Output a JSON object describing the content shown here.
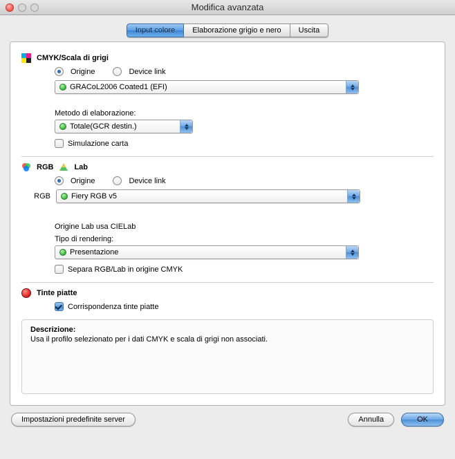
{
  "window": {
    "title": "Modifica avanzata"
  },
  "tabs": {
    "items": [
      {
        "label": "Input colore",
        "active": true
      },
      {
        "label": "Elaborazione grigio e nero",
        "active": false
      },
      {
        "label": "Uscita",
        "active": false
      }
    ]
  },
  "cmyk": {
    "heading": "CMYK/Scala di grigi",
    "radio_source": "Origine",
    "radio_devicelink": "Device link",
    "profile": "GRACoL2006 Coated1 (EFI)",
    "processing_label": "Metodo di elaborazione:",
    "processing_value": "Totale(GCR destin.)",
    "paper_sim": "Simulazione carta"
  },
  "rgb": {
    "heading_rgb": "RGB",
    "heading_lab": "Lab",
    "radio_source": "Origine",
    "radio_devicelink": "Device link",
    "sidelabel": "RGB",
    "profile": "Fiery RGB v5",
    "lab_note": "Origine Lab usa CIELab",
    "rendering_label": "Tipo di rendering:",
    "rendering_value": "Presentazione",
    "separate": "Separa RGB/Lab in origine CMYK"
  },
  "spot": {
    "heading": "Tinte piatte",
    "match": "Corrispondenza tinte piatte"
  },
  "description": {
    "title": "Descrizione:",
    "text": "Usa il profilo selezionato per i dati CMYK e scala di grigi non associati."
  },
  "footer": {
    "server_defaults": "Impostazioni predefinite server",
    "cancel": "Annulla",
    "ok": "OK"
  }
}
